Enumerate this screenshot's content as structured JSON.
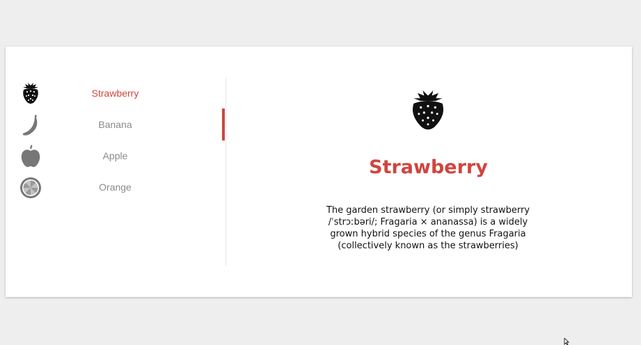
{
  "tabs": [
    {
      "label": "Strawberry",
      "icon": "strawberry-icon",
      "active": true
    },
    {
      "label": "Banana",
      "icon": "banana-icon",
      "active": false
    },
    {
      "label": "Apple",
      "icon": "apple-icon",
      "active": false
    },
    {
      "label": "Orange",
      "icon": "orange-icon",
      "active": false
    }
  ],
  "panel": {
    "icon": "strawberry-icon",
    "title": "Strawberry",
    "description": "The garden strawberry (or simply strawberry /ˈstrɔːbəri/; Fragaria × ananassa) is a widely grown hybrid species of the genus Fragaria (collectively known as the strawberries)"
  },
  "colors": {
    "accent": "#d0453f",
    "inactive_text": "#8a8a8a",
    "inactive_icon": "#777777",
    "active_icon": "#111111",
    "background": "#eeeeee",
    "card": "#ffffff"
  }
}
